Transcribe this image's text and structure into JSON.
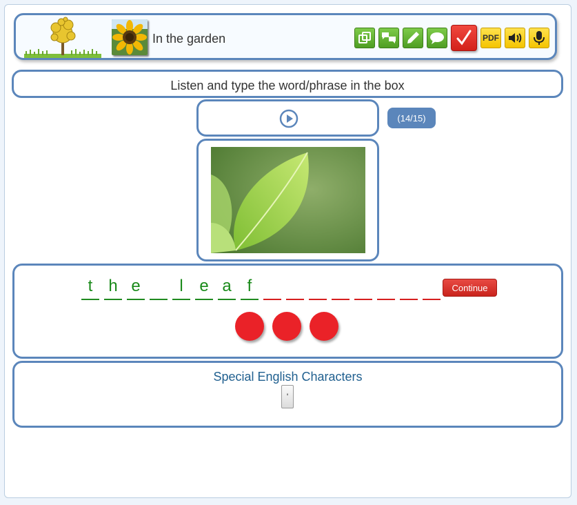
{
  "header": {
    "title": "In the garden",
    "tools": [
      {
        "icon": "flashcards-icon",
        "style": "green"
      },
      {
        "icon": "matching-icon",
        "style": "green"
      },
      {
        "icon": "pencil-icon",
        "style": "green"
      },
      {
        "icon": "speech-bubble-icon",
        "style": "green"
      },
      {
        "icon": "checkmark-icon",
        "style": "red"
      },
      {
        "icon": "pdf-icon",
        "style": "yellow",
        "label": "PDF"
      },
      {
        "icon": "speaker-icon",
        "style": "yellow"
      },
      {
        "icon": "microphone-icon",
        "style": "yellow"
      }
    ]
  },
  "instruction": "Listen and type the word/phrase in the box",
  "progress": "(14/15)",
  "answer": {
    "letters": [
      "t",
      "h",
      "e",
      "",
      "l",
      "e",
      "a",
      "f",
      "",
      "",
      "",
      "",
      "",
      "",
      "",
      ""
    ],
    "filled": [
      true,
      true,
      true,
      true,
      true,
      true,
      true,
      true,
      false,
      false,
      false,
      false,
      false,
      false,
      false,
      false
    ],
    "continue_label": "Continue",
    "attempts": 3
  },
  "special": {
    "title": "Special English Characters",
    "chars": [
      "'"
    ]
  },
  "colors": {
    "border": "#5b86bb",
    "correct": "#1a8a1a",
    "empty": "#d61e1e",
    "dot": "#ea2228"
  }
}
